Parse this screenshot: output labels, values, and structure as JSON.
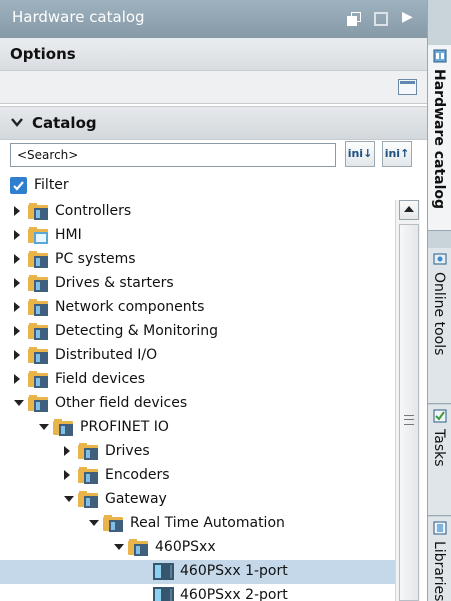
{
  "panel": {
    "title": "Hardware catalog",
    "options_label": "Options",
    "catalog_label": "Catalog"
  },
  "search": {
    "value": "<Search>",
    "down_label": "ini↓",
    "up_label": "ini↑"
  },
  "filter": {
    "label": "Filter",
    "checked": true
  },
  "tree": {
    "items": [
      {
        "label": "Controllers",
        "level": 0,
        "expanded": false,
        "icon": "folder-icon"
      },
      {
        "label": "HMI",
        "level": 0,
        "expanded": false,
        "icon": "hmi-folder-icon"
      },
      {
        "label": "PC systems",
        "level": 0,
        "expanded": false,
        "icon": "folder-icon"
      },
      {
        "label": "Drives & starters",
        "level": 0,
        "expanded": false,
        "icon": "folder-icon"
      },
      {
        "label": "Network components",
        "level": 0,
        "expanded": false,
        "icon": "folder-icon"
      },
      {
        "label": "Detecting & Monitoring",
        "level": 0,
        "expanded": false,
        "icon": "folder-icon"
      },
      {
        "label": "Distributed I/O",
        "level": 0,
        "expanded": false,
        "icon": "folder-icon"
      },
      {
        "label": "Field devices",
        "level": 0,
        "expanded": false,
        "icon": "folder-icon"
      },
      {
        "label": "Other field devices",
        "level": 0,
        "expanded": true,
        "icon": "folder-icon"
      },
      {
        "label": "PROFINET IO",
        "level": 1,
        "expanded": true,
        "icon": "folder-icon"
      },
      {
        "label": "Drives",
        "level": 2,
        "expanded": false,
        "icon": "folder-icon"
      },
      {
        "label": "Encoders",
        "level": 2,
        "expanded": false,
        "icon": "folder-icon"
      },
      {
        "label": "Gateway",
        "level": 2,
        "expanded": true,
        "icon": "folder-icon"
      },
      {
        "label": "Real Time Automation",
        "level": 3,
        "expanded": true,
        "icon": "folder-icon"
      },
      {
        "label": "460PSxx",
        "level": 4,
        "expanded": true,
        "icon": "folder-icon"
      },
      {
        "label": "460PSxx 1-port",
        "level": 5,
        "selected": true,
        "icon": "device-icon"
      },
      {
        "label": "460PSxx 2-port",
        "level": 5,
        "selected": false,
        "icon": "device-icon"
      }
    ]
  },
  "side_tabs": [
    {
      "label": "Hardware catalog",
      "active": true,
      "icon": "catalog-icon"
    },
    {
      "label": "Online tools",
      "active": false,
      "icon": "online-tools-icon"
    },
    {
      "label": "Tasks",
      "active": false,
      "icon": "tasks-icon"
    },
    {
      "label": "Libraries",
      "active": false,
      "icon": "libraries-icon"
    }
  ],
  "colors": {
    "titlebar": "#8ea1ae",
    "selection": "#c4d8ea",
    "folder": "#e9b44a",
    "checkbox": "#2f7fce"
  }
}
